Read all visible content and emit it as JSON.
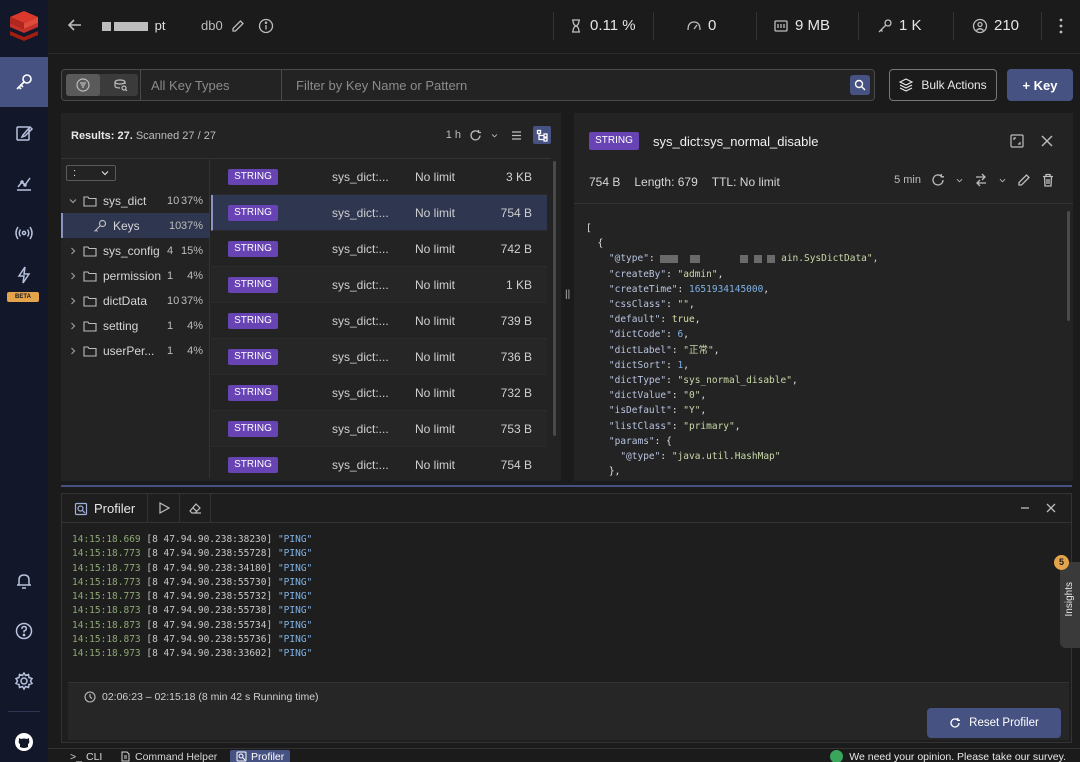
{
  "header": {
    "db_name": "pt",
    "db_index": "db0",
    "metrics": [
      {
        "icon": "cpu-icon",
        "value": "0.11 %"
      },
      {
        "icon": "gauge-icon",
        "value": "0"
      },
      {
        "icon": "memory-icon",
        "value": "9 MB"
      },
      {
        "icon": "key-icon",
        "value": "1 K"
      },
      {
        "icon": "user-icon",
        "value": "210"
      }
    ]
  },
  "sidebar": {
    "beta_label": "BETA"
  },
  "filter": {
    "type_placeholder": "All Key Types",
    "key_placeholder": "Filter by Key Name or Pattern",
    "bulk_actions_label": "Bulk Actions",
    "add_key_label": "+ Key"
  },
  "browser": {
    "results_label": "Results: 27.",
    "scanned_label": "Scanned 27 / 27",
    "refresh_age": "1 h",
    "delimiter": ":",
    "tree": [
      {
        "name": "sys_dict",
        "count": "10",
        "pct": "37%",
        "expanded": true
      },
      {
        "name": "Keys",
        "count": "10",
        "pct": "37%",
        "selected": true,
        "leaf": true
      },
      {
        "name": "sys_config",
        "count": "4",
        "pct": "15%"
      },
      {
        "name": "permission",
        "count": "1",
        "pct": "4%"
      },
      {
        "name": "dictData",
        "count": "10",
        "pct": "37%"
      },
      {
        "name": "setting",
        "count": "1",
        "pct": "4%"
      },
      {
        "name": "userPer...",
        "count": "1",
        "pct": "4%"
      }
    ],
    "keys": [
      {
        "type": "STRING",
        "name": "sys_dict:...",
        "ttl": "No limit",
        "size": "3 KB"
      },
      {
        "type": "STRING",
        "name": "sys_dict:...",
        "ttl": "No limit",
        "size": "754 B",
        "selected": true
      },
      {
        "type": "STRING",
        "name": "sys_dict:...",
        "ttl": "No limit",
        "size": "742 B"
      },
      {
        "type": "STRING",
        "name": "sys_dict:...",
        "ttl": "No limit",
        "size": "1 KB"
      },
      {
        "type": "STRING",
        "name": "sys_dict:...",
        "ttl": "No limit",
        "size": "739 B"
      },
      {
        "type": "STRING",
        "name": "sys_dict:...",
        "ttl": "No limit",
        "size": "736 B"
      },
      {
        "type": "STRING",
        "name": "sys_dict:...",
        "ttl": "No limit",
        "size": "732 B"
      },
      {
        "type": "STRING",
        "name": "sys_dict:...",
        "ttl": "No limit",
        "size": "753 B"
      },
      {
        "type": "STRING",
        "name": "sys_dict:...",
        "ttl": "No limit",
        "size": "754 B"
      }
    ]
  },
  "details": {
    "type": "STRING",
    "key_name": "sys_dict:sys_normal_disable",
    "size": "754 B",
    "length": "Length: 679",
    "ttl": "TTL:",
    "ttl_value": "No limit",
    "refresh_age": "5 min",
    "json": {
      "open_bracket": "[",
      "open_brace": "{",
      "type_key": "\"@type\"",
      "type_tail": "ain.SysDictData\",",
      "create_by_key": "\"createBy\"",
      "create_by_val": "\"admin\"",
      "create_time_key": "\"createTime\"",
      "create_time_val": "1651934145000",
      "css_class_key": "\"cssClass\"",
      "css_class_val": "\"\"",
      "default_key": "\"default\"",
      "default_val": "true",
      "dict_code_key": "\"dictCode\"",
      "dict_code_val": "6",
      "dict_label_key": "\"dictLabel\"",
      "dict_label_val": "\"正常\"",
      "dict_sort_key": "\"dictSort\"",
      "dict_sort_val": "1",
      "dict_type_key": "\"dictType\"",
      "dict_type_val": "\"sys_normal_disable\"",
      "dict_value_key": "\"dictValue\"",
      "dict_value_val": "\"0\"",
      "is_default_key": "\"isDefault\"",
      "is_default_val": "\"Y\"",
      "list_class_key": "\"listClass\"",
      "list_class_val": "\"primary\"",
      "params_key": "\"params\"",
      "params_open": "{",
      "params_type_key": "\"@type\"",
      "params_type_val": "\"java.util.HashMap\"",
      "params_close": "},"
    }
  },
  "profiler": {
    "tab_label": "Profiler",
    "log": [
      {
        "time": "14:15:18.669",
        "src": "[8 47.94.90.238:38230]",
        "cmd": "\"PING\""
      },
      {
        "time": "14:15:18.773",
        "src": "[8 47.94.90.238:55728]",
        "cmd": "\"PING\""
      },
      {
        "time": "14:15:18.773",
        "src": "[8 47.94.90.238:34180]",
        "cmd": "\"PING\""
      },
      {
        "time": "14:15:18.773",
        "src": "[8 47.94.90.238:55730]",
        "cmd": "\"PING\""
      },
      {
        "time": "14:15:18.773",
        "src": "[8 47.94.90.238:55732]",
        "cmd": "\"PING\""
      },
      {
        "time": "14:15:18.873",
        "src": "[8 47.94.90.238:55738]",
        "cmd": "\"PING\""
      },
      {
        "time": "14:15:18.873",
        "src": "[8 47.94.90.238:55734]",
        "cmd": "\"PING\""
      },
      {
        "time": "14:15:18.873",
        "src": "[8 47.94.90.238:55736]",
        "cmd": "\"PING\""
      },
      {
        "time": "14:15:18.973",
        "src": "[8 47.94.90.238:33602]",
        "cmd": "\"PING\""
      }
    ],
    "running_time": "02:06:23 – 02:15:18 (8 min 42 s Running time)",
    "reset_label": "Reset Profiler"
  },
  "insights": {
    "count": "5",
    "label": "Insights"
  },
  "bottombar": {
    "cli_label": "CLI",
    "command_helper_label": "Command Helper",
    "profiler_label": "Profiler",
    "survey_label": "We need your opinion. Please take our survey."
  },
  "colors": {
    "accent": "#465282",
    "string_badge": "#6843b3",
    "beta_badge": "#e3a44b"
  }
}
